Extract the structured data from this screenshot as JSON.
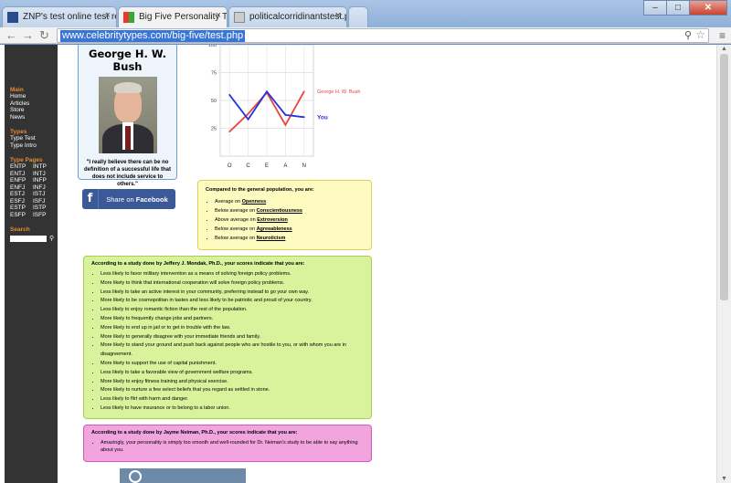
{
  "browser": {
    "tabs": [
      {
        "label": "ZNP's test online test resu",
        "active": false
      },
      {
        "label": "Big Five Personality Test",
        "active": true
      },
      {
        "label": "politicalcorridinantstest.p",
        "active": false
      }
    ],
    "url": "www.celebritytypes.com/big-five/test.php"
  },
  "sidebar": {
    "main_title": "Main",
    "main_links": [
      "Home",
      "Articles",
      "Store",
      "News"
    ],
    "types_title": "Types",
    "types_links": [
      "Type Test",
      "Type Intro"
    ],
    "pages_title": "Type Pages",
    "type_pages": [
      "ENTP",
      "INTP",
      "ENTJ",
      "INTJ",
      "ENFP",
      "INFP",
      "ENFJ",
      "INFJ",
      "ESTJ",
      "ISTJ",
      "ESFJ",
      "ISFJ",
      "ESTP",
      "ISTP",
      "ESFP",
      "ISFP"
    ],
    "search_title": "Search"
  },
  "profile": {
    "name": "George H. W. Bush",
    "quote": "\"I really believe there can be no definition of a successful life that does not include service to others.\""
  },
  "facebook": {
    "share_prefix": "Share on ",
    "share_brand": "Facebook"
  },
  "chart_data": {
    "type": "line",
    "categories": [
      "O",
      "C",
      "E",
      "A",
      "N"
    ],
    "yticks": [
      25,
      50,
      75,
      100
    ],
    "ylim": [
      0,
      100
    ],
    "grid": true,
    "legend": "right (labels at line ends)",
    "series": [
      {
        "name": "George H. W. Bush",
        "color": "#e8443c",
        "values": [
          22,
          38,
          57,
          28,
          58
        ]
      },
      {
        "name": "You",
        "color": "#2233e0",
        "values": [
          55,
          33,
          58,
          37,
          35
        ]
      }
    ]
  },
  "summary": {
    "heading": "Compared to the general population, you are:",
    "items": [
      {
        "prefix": "Average on ",
        "trait": "Openness"
      },
      {
        "prefix": "Below average on ",
        "trait": "Conscientiousness"
      },
      {
        "prefix": "Above average on ",
        "trait": "Extroversion"
      },
      {
        "prefix": "Below average on ",
        "trait": "Agreeableness"
      },
      {
        "prefix": "Below average on ",
        "trait": "Neuroticism"
      }
    ]
  },
  "study1": {
    "heading": "According to a study done by Jeffery J. Mondak, Ph.D., your scores indicate that you are:",
    "items": [
      "Less likely to favor military intervention as a means of solving foreign policy problems.",
      "More likely to think that international cooperation will solve foreign policy problems.",
      "Less likely to take an active interest in your community, preferring instead to go your own way.",
      "More likely to be cosmopolitan in tastes and less likely to be patriotic and proud of your country.",
      "Less likely to enjoy romantic fiction than the rest of the population.",
      "More likely to frequently change jobs and partners.",
      "More likely to end up in jail or to get in trouble with the law.",
      "More likely to generally disagree with your immediate friends and family.",
      "More likely to stand your ground and push back against people who are hostile to you, or with whom you are in disagreement.",
      "More likely to support the use of capital punishment.",
      "Less likely to take a favorable view of government welfare programs.",
      "More likely to enjoy fitness training and physical exercise.",
      "More likely to nurture a few select beliefs that you regard as settled in stone.",
      "Less likely to flirt with harm and danger.",
      "Less likely to have insurance or to belong to a labor union."
    ]
  },
  "study2": {
    "heading": "According to a study done by Jayme Neiman, Ph.D., your scores indicate that you are:",
    "items": [
      "Amazingly, your personality is simply too smooth and well-rounded for Dr. Neiman's study to be able to say anything about you."
    ]
  }
}
